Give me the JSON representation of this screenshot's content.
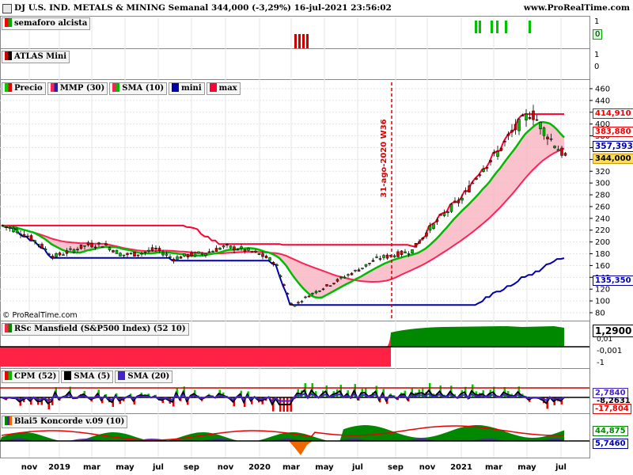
{
  "header": {
    "title": "DJ U.S. IND. METALS & MINING Semanal 344,000 (-3,29%) 16-jul-2021 23:56:02",
    "site": "www.ProRealTime.com"
  },
  "panels": {
    "semaforo": {
      "label": "semaforo alcista",
      "axis": [
        "1",
        "0"
      ]
    },
    "atlas": {
      "label": "ATLAS Mini",
      "axis": [
        "1",
        "0"
      ]
    },
    "price": {
      "legend": [
        "Precio",
        "MMP (30)",
        "SMA (10)",
        "mini",
        "max"
      ],
      "annotation": "31-ago-2020 W36",
      "copyright": "© ProRealTime.com",
      "value_labels": [
        "414,910",
        "383,880",
        "357,393",
        "344,000",
        "135,350"
      ]
    },
    "rsc": {
      "label": "RSc Mansfield (S&P500 Index) (52 10)",
      "value": "1,2900",
      "axis": [
        "0,01",
        "-0,001",
        "-1"
      ]
    },
    "cpm": {
      "legend": [
        "CPM (52)",
        "SMA (5)",
        "SMA (20)"
      ],
      "value_labels": [
        "2,7840",
        "-8,2631",
        "-17,804"
      ]
    },
    "blai": {
      "label": "Blai5 Koncorde v.09 (10)",
      "value_labels": [
        "44,875",
        "5,7460"
      ]
    }
  },
  "colors": {
    "up_candle": "#00c000",
    "down_candle": "#e00000",
    "sma10": "#00bb00",
    "mmp30": "#ff2255",
    "mini": "#0000aa",
    "max": "#ff0033",
    "rsc_pos": "#008800",
    "rsc_neg": "#ff2244"
  },
  "chart_data": {
    "type": "candlestick",
    "y_ticks": [
      80,
      100,
      120,
      140,
      160,
      180,
      200,
      220,
      240,
      260,
      280,
      300,
      320,
      340,
      360,
      380,
      400,
      420,
      440,
      460
    ],
    "ylim": [
      70,
      465
    ],
    "x_labels": [
      "nov",
      "2019",
      "mar",
      "may",
      "jul",
      "sep",
      "nov",
      "2020",
      "mar",
      "may",
      "jul",
      "sep",
      "nov",
      "2021",
      "mar",
      "may",
      "jul"
    ],
    "close_path": [
      [
        "2018-10",
        228
      ],
      [
        "2018-11",
        218
      ],
      [
        "2018-12",
        200
      ],
      [
        "2019-01",
        175
      ],
      [
        "2019-02",
        185
      ],
      [
        "2019-03",
        195
      ],
      [
        "2019-04",
        195
      ],
      [
        "2019-05",
        178
      ],
      [
        "2019-06",
        180
      ],
      [
        "2019-07",
        188
      ],
      [
        "2019-08",
        172
      ],
      [
        "2019-09",
        178
      ],
      [
        "2019-10",
        182
      ],
      [
        "2019-11",
        192
      ],
      [
        "2019-12",
        188
      ],
      [
        "2020-01",
        180
      ],
      [
        "2020-02",
        165
      ],
      [
        "2020-03",
        90
      ],
      [
        "2020-04",
        110
      ],
      [
        "2020-05",
        125
      ],
      [
        "2020-06",
        140
      ],
      [
        "2020-07",
        155
      ],
      [
        "2020-08",
        172
      ],
      [
        "2020-09",
        178
      ],
      [
        "2020-10",
        185
      ],
      [
        "2020-11",
        220
      ],
      [
        "2020-12",
        250
      ],
      [
        "2021-01",
        275
      ],
      [
        "2021-02",
        320
      ],
      [
        "2021-03",
        350
      ],
      [
        "2021-04",
        390
      ],
      [
        "2021-05",
        420
      ],
      [
        "2021-06",
        380
      ],
      [
        "2021-07",
        344
      ]
    ],
    "last_close": 344.0,
    "change_pct": -3.29
  }
}
